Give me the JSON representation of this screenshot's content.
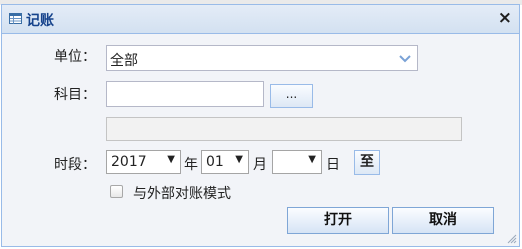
{
  "dialog": {
    "title": "记账",
    "title_icon": "table-icon",
    "close_glyph": "×"
  },
  "form": {
    "unit": {
      "label": "单位：",
      "value": "全部"
    },
    "subject": {
      "label": "科目：",
      "value": "",
      "browse_label": "...",
      "extra_value": ""
    },
    "period": {
      "label": "时段：",
      "year": "2017",
      "year_unit": "年",
      "month": "01",
      "month_unit": "月",
      "day": "",
      "day_unit": "日",
      "to_label": "至"
    },
    "external_mode": {
      "label": "与外部对账模式",
      "checked": false
    }
  },
  "buttons": {
    "open": "打开",
    "cancel": "取消"
  },
  "colors": {
    "title_text": "#15428b",
    "border": "#99bbe8",
    "dialog_bg": "#f2f4f8"
  }
}
